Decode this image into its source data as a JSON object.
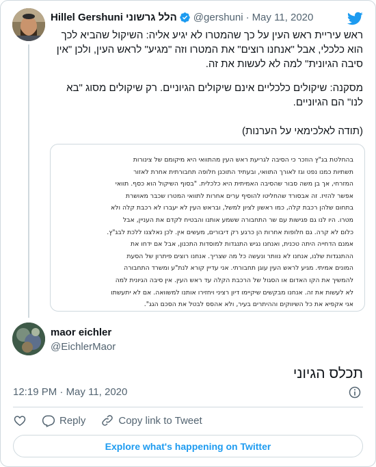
{
  "tweet": {
    "author_name": "Hillel Gershuni הלל גרשוני",
    "author_handle": "@gershuni",
    "separator": "·",
    "date": "May 11, 2020",
    "paragraphs": [
      "ראש עיריית ראש העין על כך שהמטרו לא יגיע אליה: השיקול שהביא לכך הוא כלכלי, אבל \"אנחנו רוצים\" את המטרו וזה \"מגיע\" לראש העין, ולכן \"אין סיבה הגיונית\" למה לא לעשות את זה.",
      "מסקנה: שיקולים כלכליים אינם שיקולים הגיוניים. רק שיקולים מסוג \"בא לנו\" הם הגיוניים.",
      "(תודה לאלכימאי על הערנות)"
    ],
    "quoted_image_lines": [
      "בהחלטת בג\"ץ הוזכר כי הסיבה לגריעת ראש העין מהתוואי היא מיקומם של צינורות",
      "תשתיות כמנו נפט וגז לאורך התוואי, ובעתיד התוכנן חלופה תחבורתית אחרת לאזור",
      "המזרחי, אך בן משה סבור שהסיבה האמיתית היא כלכלית. \"בסוף השיקול הוא כסף. תוואי",
      "אפשר להזיז. זה אבסורד שהחליטו להוסיף ערים אחרות לתוואי המטרו שכבר מאושרת",
      "בתחום שלהן רכבת קלה, כמו ראשון לציון למשל, ובראש העין לא יעברו לא רכבת קלה ולא",
      "מטרו. היו לנו גם פגישות עם שר התחבורה ששמע אותנו והבטיח לקדם את העניין, אבל",
      "כלום לא קרה. גם חלופות אחרות הן כרגע רק דיבורים, מעשים אין. לכן נאלצנו ללכת לבג\"ץ.",
      "אמנם הדחייה היתה טכנית, ואנחנו נגיש התנגדות למוסדות התכנון, אבל אם ידחו את",
      "ההתנגדות שלנו, אנחנו לא נוותר ונעשה כל מה שצריך. אנחנו רוצים פיתרון של הסעת",
      "המונים אמיתי. מגיע לראש העין עוגן תחבורתי. אני עדיין קורא לנת\"ע ומשרד התחבורה",
      "להמשיך את הקו האדום או הסגול של הרכבת הקלה עד ראש העין. אין סיבה הגיונית למה",
      "לא לעשות את זה. אנחנו מבקשים שיקיימו דיון רציני ויחזירו אותנו למשוואה. אם לא יתעשתו",
      "אני אקפיא את כל השיווקים וההיתרים בעיר, ולא אהסס לבטל את הסכם הגג\"."
    ]
  },
  "reply": {
    "author_name": "maor eichler",
    "author_handle": "@EichlerMaor",
    "text": "תכלס הגיוני",
    "time": "12:19 PM",
    "separator": "·",
    "date": "May 11, 2020"
  },
  "actions": {
    "reply_label": "Reply",
    "copy_link_label": "Copy link to Tweet"
  },
  "explore_label": "Explore what's happening on Twitter",
  "colors": {
    "twitter_blue": "#1d9bf0",
    "secondary_text": "#536471",
    "border": "#cfd9de",
    "highlight": "#fff36a"
  },
  "icons": [
    "twitter-bird-icon",
    "verified-badge-icon",
    "info-icon",
    "heart-icon",
    "reply-icon",
    "link-icon"
  ]
}
